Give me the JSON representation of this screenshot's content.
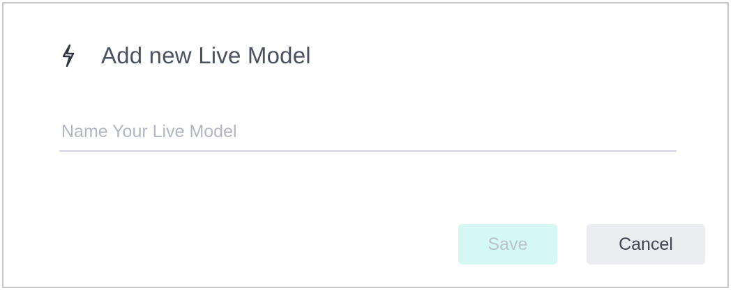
{
  "dialog": {
    "icon": "bolt-icon",
    "title": "Add new Live Model",
    "name_input": {
      "placeholder": "Name Your Live Model",
      "value": ""
    },
    "save_label": "Save",
    "save_enabled": false,
    "cancel_label": "Cancel"
  },
  "colors": {
    "title_text": "#4a5160",
    "placeholder_text": "#b2b6c3",
    "input_underline": "#d2d3de",
    "save_bg_disabled": "#d6f8f5",
    "save_text_disabled": "#b9c4c8",
    "cancel_bg": "#ecedf0",
    "cancel_text": "#3f4452",
    "dialog_border": "#c8c8c8"
  }
}
